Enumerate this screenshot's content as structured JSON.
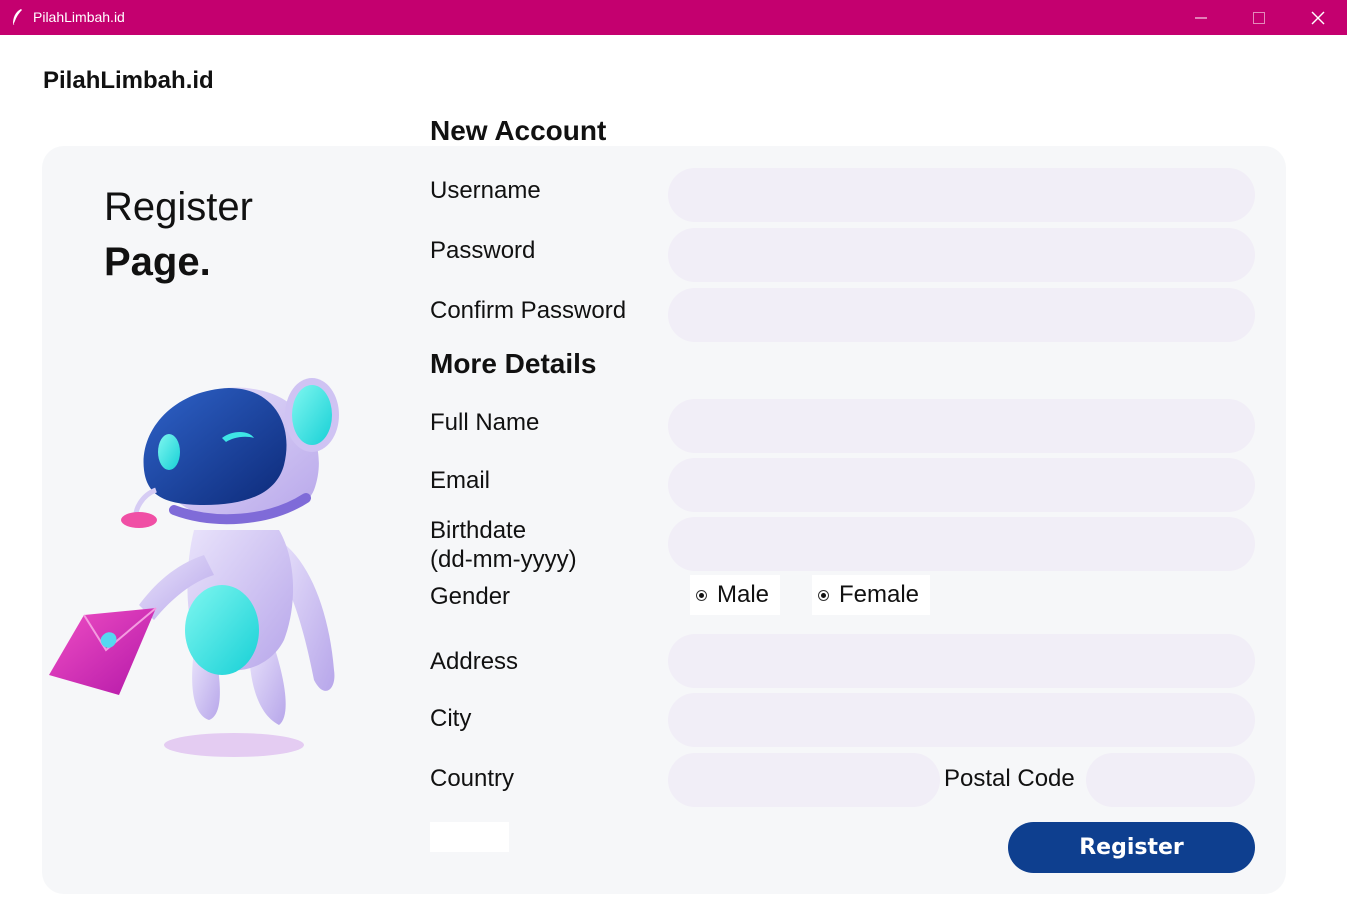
{
  "window": {
    "title": "PilahLimbah.id",
    "accent_color": "#c4006f",
    "controls": [
      "minimize-icon",
      "maximize-icon",
      "close-icon"
    ]
  },
  "brand": "PilahLimbah.id",
  "hero": {
    "line1": "Register",
    "line2": "Page.",
    "illustration": "robot-mascot-with-envelope"
  },
  "sections": {
    "new_account": "New Account",
    "more_details": "More Details"
  },
  "labels": {
    "username": "Username",
    "password": "Password",
    "confirm_password": "Confirm Password",
    "full_name": "Full Name",
    "email": "Email",
    "birthdate_line1": "Birthdate",
    "birthdate_line2": "(dd-mm-yyyy)",
    "gender": "Gender",
    "address": "Address",
    "city": "City",
    "country": "Country",
    "postal_code": "Postal Code"
  },
  "fields": {
    "username": "",
    "password": "",
    "confirm_password": "",
    "full_name": "",
    "email": "",
    "birthdate": "",
    "address": "",
    "city": "",
    "country": "",
    "postal_code": ""
  },
  "gender_options": [
    "Male",
    "Female"
  ],
  "register_button": "Register",
  "colors": {
    "field_bg": "#f1eef7",
    "card_bg": "#f6f7f9",
    "button_bg": "#0e3f8f"
  }
}
